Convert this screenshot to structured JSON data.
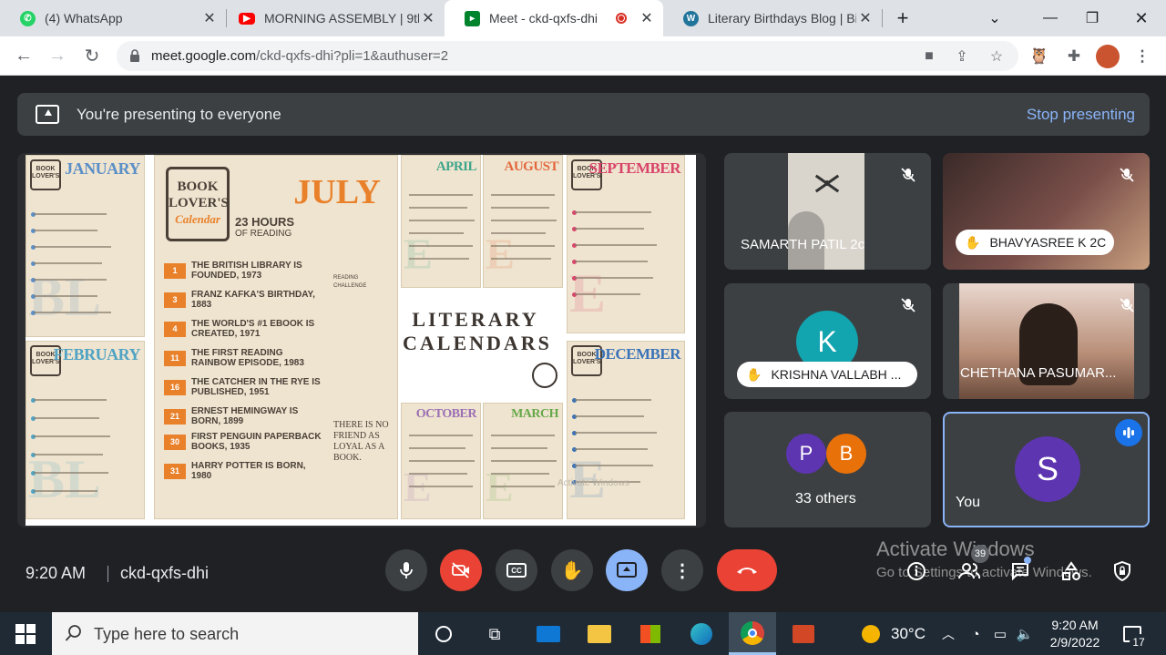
{
  "browser": {
    "tabs": [
      {
        "title": "(4) WhatsApp",
        "favicon": "whatsapp-icon"
      },
      {
        "title": "MORNING ASSEMBLY | 9th",
        "favicon": "youtube-icon"
      },
      {
        "title": "Meet - ckd-qxfs-dhi",
        "favicon": "meet-icon",
        "active": true
      },
      {
        "title": "Literary Birthdays Blog | Bi",
        "favicon": "wordpress-icon"
      }
    ],
    "new_tab": "+",
    "url_host": "meet.google.com",
    "url_rest": "/ckd-qxfs-dhi?pli=1&authuser=2"
  },
  "meet": {
    "banner_text": "You're presenting to everyone",
    "stop_presenting": "Stop presenting",
    "slide": {
      "title_line1": "LITERARY",
      "title_line2": "CALENDARS",
      "july": {
        "logo_line1": "BOOK",
        "logo_line2": "LOVER'S",
        "logo_line3": "Calendar",
        "month": "JULY",
        "hours": "23 HOURS",
        "hours_sub": "OF READING",
        "events": [
          {
            "day": "1",
            "text": "THE BRITISH LIBRARY IS FOUNDED, 1973"
          },
          {
            "day": "3",
            "text": "FRANZ KAFKA'S BIRTHDAY, 1883"
          },
          {
            "day": "4",
            "text": "THE WORLD'S #1 EBOOK IS CREATED, 1971"
          },
          {
            "day": "11",
            "text": "THE FIRST READING RAINBOW EPISODE, 1983"
          },
          {
            "day": "16",
            "text": "THE CATCHER IN THE RYE IS PUBLISHED, 1951"
          },
          {
            "day": "21",
            "text": "ERNEST HEMINGWAY IS BORN, 1899"
          },
          {
            "day": "30",
            "text": "FIRST PENGUIN PAPERBACK BOOKS, 1935"
          },
          {
            "day": "31",
            "text": "HARRY POTTER IS BORN, 1980"
          }
        ],
        "reading_challenge": "READING CHALLENGE",
        "quote": "THERE IS NO FRIEND AS LOYAL AS A BOOK."
      },
      "months": [
        {
          "name": "JANUARY",
          "color": "#5b8fc7"
        },
        {
          "name": "FEBRUARY",
          "color": "#4fa3c4"
        },
        {
          "name": "APRIL",
          "color": "#3fa58a"
        },
        {
          "name": "AUGUST",
          "color": "#e2673c"
        },
        {
          "name": "SEPTEMBER",
          "color": "#d8456b"
        },
        {
          "name": "OCTOBER",
          "color": "#9b6fb5"
        },
        {
          "name": "MARCH",
          "color": "#67a84b"
        },
        {
          "name": "DECEMBER",
          "color": "#3b73b8"
        }
      ],
      "watermark": "Activate Windows"
    },
    "participants": [
      {
        "name": "SAMARTH PATIL 2c",
        "muted": true
      },
      {
        "name": "BHAVYASREE K 2C",
        "muted": true,
        "hand_raised": true
      },
      {
        "name": "KRISHNA VALLABH ...",
        "muted": true,
        "hand_raised": true,
        "initial": "K",
        "color": "#12a4af"
      },
      {
        "name": "CHETHANA PASUMAR...",
        "muted": true
      }
    ],
    "others": {
      "label": "33 others",
      "avatars": [
        {
          "initial": "P",
          "color": "#5e35b1"
        },
        {
          "initial": "B",
          "color": "#e8710a"
        }
      ]
    },
    "self": {
      "label": "You",
      "initial": "S",
      "color": "#5e35b1"
    },
    "clock": "9:20 AM",
    "meeting_code": "ckd-qxfs-dhi",
    "people_count": "39",
    "activate_line1": "Activate Windows",
    "activate_line2": "Go to Settings to activate Windows."
  },
  "taskbar": {
    "search_placeholder": "Type here to search",
    "weather": "30°C",
    "time": "9:20 AM",
    "date": "2/9/2022",
    "notifications": "17"
  }
}
